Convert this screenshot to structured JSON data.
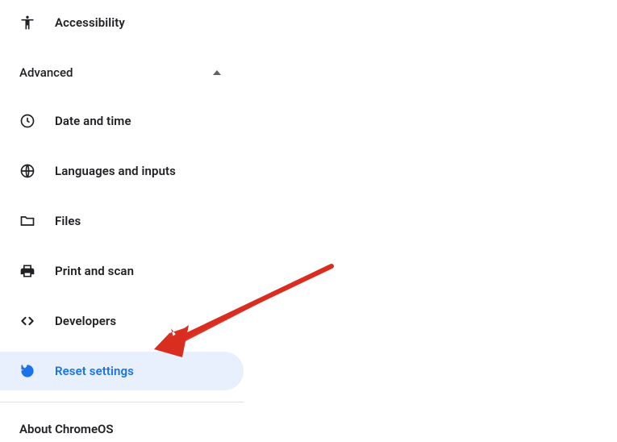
{
  "sidebar": {
    "items": [
      {
        "label": "Accessibility",
        "icon": "accessibility-icon"
      },
      {
        "label": "Date and time",
        "icon": "clock-icon"
      },
      {
        "label": "Languages and inputs",
        "icon": "globe-icon"
      },
      {
        "label": "Files",
        "icon": "folder-icon"
      },
      {
        "label": "Print and scan",
        "icon": "printer-icon"
      },
      {
        "label": "Developers",
        "icon": "code-icon"
      },
      {
        "label": "Reset settings",
        "icon": "reset-icon"
      }
    ],
    "section_header": "Advanced",
    "about": "About ChromeOS",
    "selected_index": 6
  },
  "colors": {
    "accent": "#1a73e8",
    "selected_bg": "#e8f0fe",
    "text": "#202124",
    "annotation_arrow": "#d92d20"
  }
}
